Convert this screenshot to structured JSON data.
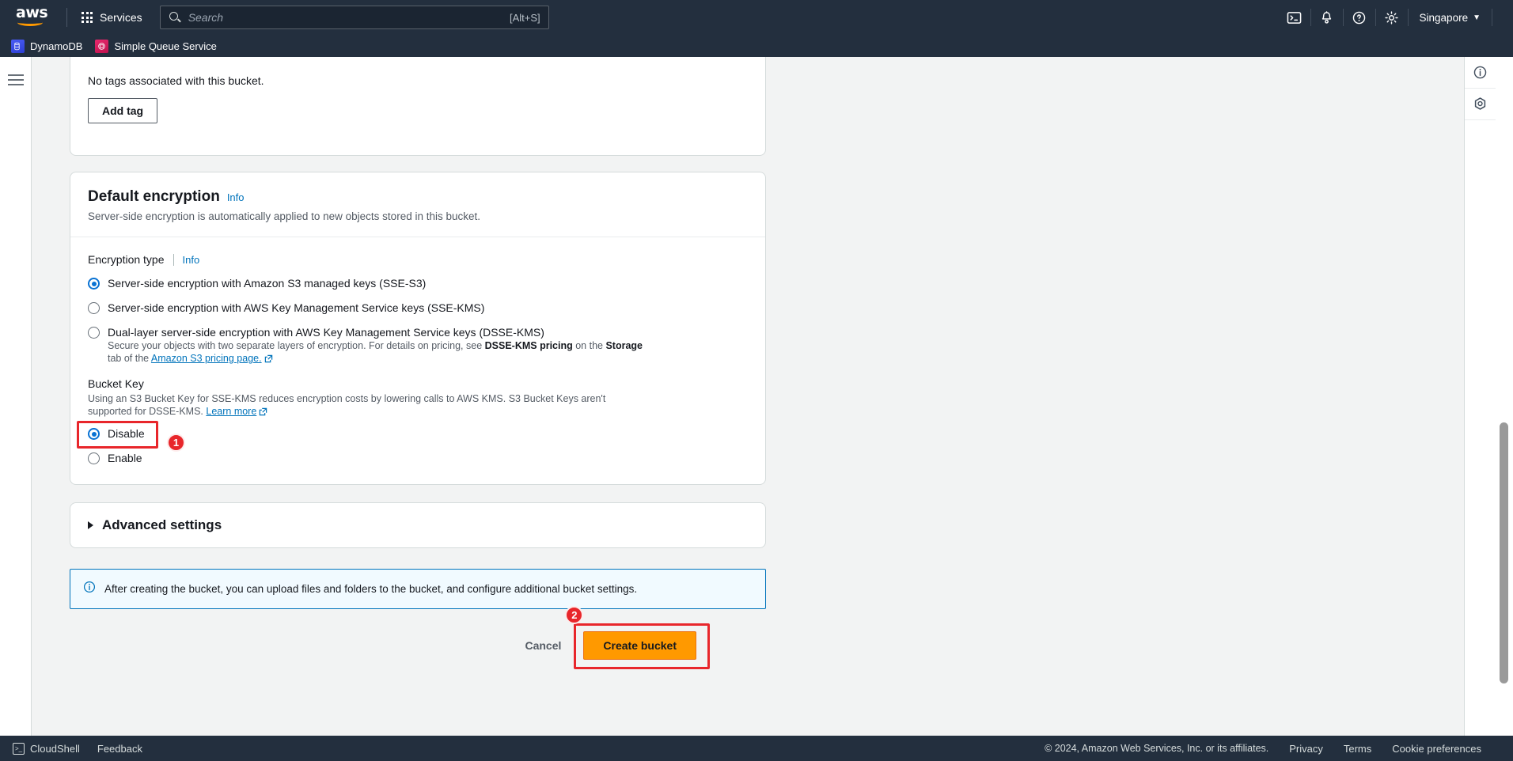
{
  "topnav": {
    "logo_text": "aws",
    "services_label": "Services",
    "search_placeholder": "Search",
    "search_value": "",
    "search_shortcut": "[Alt+S]",
    "region": "Singapore",
    "caret": "▼",
    "icons": {
      "cloudshell": "cloudshell-icon",
      "notifications": "bell-icon",
      "help": "help-circle-icon",
      "settings": "gear-icon"
    }
  },
  "service_tabs": [
    {
      "name": "DynamoDB",
      "icon": "dynamodb-icon"
    },
    {
      "name": "Simple Queue Service",
      "icon": "sqs-icon"
    }
  ],
  "right_rail": [
    {
      "name": "info-panel-icon",
      "glyph": "i"
    },
    {
      "name": "shortcuts-icon",
      "glyph": "S"
    }
  ],
  "tags_section": {
    "empty_text": "No tags associated with this bucket.",
    "add_tag_label": "Add tag"
  },
  "encryption": {
    "title": "Default encryption",
    "info_label": "Info",
    "description": "Server-side encryption is automatically applied to new objects stored in this bucket.",
    "type_label": "Encryption type",
    "type_info_label": "Info",
    "options": [
      {
        "label": "Server-side encryption with Amazon S3 managed keys (SSE-S3)",
        "selected": true
      },
      {
        "label": "Server-side encryption with AWS Key Management Service keys (SSE-KMS)",
        "selected": false
      },
      {
        "label": "Dual-layer server-side encryption with AWS Key Management Service keys (DSSE-KMS)",
        "selected": false
      }
    ],
    "dsse_note": {
      "part1": "Secure your objects with two separate layers of encryption. For details on pricing, see ",
      "bold1": "DSSE-KMS pricing",
      "part2": " on the ",
      "bold2": "Storage",
      "part3": " tab of the ",
      "link": "Amazon S3 pricing page."
    },
    "bucket_key": {
      "label": "Bucket Key",
      "description": "Using an S3 Bucket Key for SSE-KMS reduces encryption costs by lowering calls to AWS KMS. S3 Bucket Keys aren't supported for DSSE-KMS. ",
      "learn_more": "Learn more",
      "options": [
        {
          "label": "Disable",
          "selected": true
        },
        {
          "label": "Enable",
          "selected": false
        }
      ]
    }
  },
  "advanced": {
    "title": "Advanced settings"
  },
  "alert": {
    "text": "After creating the bucket, you can upload files and folders to the bucket, and configure additional bucket settings.",
    "icon": "info-circle-icon"
  },
  "actions": {
    "cancel_label": "Cancel",
    "create_label": "Create bucket"
  },
  "annotations": [
    {
      "number": "1",
      "target": "bucket-key-disable-radio"
    },
    {
      "number": "2",
      "target": "create-bucket-button"
    }
  ],
  "footer": {
    "cloudshell_label": "CloudShell",
    "feedback_label": "Feedback",
    "copyright": "© 2024, Amazon Web Services, Inc. or its affiliates.",
    "links": [
      "Privacy",
      "Terms",
      "Cookie preferences"
    ]
  },
  "colors": {
    "nav_bg": "#232f3e",
    "accent_orange": "#ff9900",
    "link_blue": "#0073bb",
    "radio_blue": "#0972d3",
    "annotation_red": "#e8262b",
    "page_bg": "#f2f3f3"
  }
}
